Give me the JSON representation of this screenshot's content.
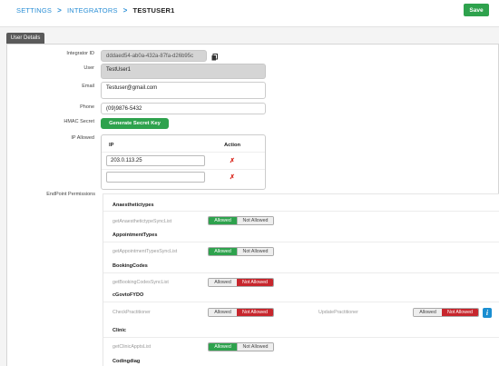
{
  "breadcrumb": {
    "settings": "SETTINGS",
    "integrators": "INTEGRATORS",
    "current": "TESTUSER1",
    "sep": ">"
  },
  "header": {
    "save_label": "Save"
  },
  "tab": {
    "label": "User Details"
  },
  "form": {
    "integrator_id_label": "Integrator ID",
    "integrator_id_value": "dddaed54-ab0a-432a-87fa-d26b95c",
    "user_label": "User",
    "user_value": "TestUser1",
    "email_label": "Email",
    "email_value": "Testuser@gmail.com",
    "phone_label": "Phone",
    "phone_value": "(09)9876-5432",
    "hmac_label": "HMAC Secret",
    "generate_label": "Generate Secret Key",
    "ip_label": "IP Allowed"
  },
  "ip_table": {
    "col_ip": "IP",
    "col_action": "Action",
    "rows": [
      "203.0.113.25",
      ""
    ],
    "remove_glyph": "✗"
  },
  "endpoints": {
    "label": "EndPoint Permissions",
    "allowed_label": "Allowed",
    "not_allowed_label": "Not Allowed",
    "groups": [
      {
        "title": "Anaesthetictypes",
        "items": [
          {
            "name": "getAnaesthetictypeSyncList",
            "state": "allowed"
          }
        ]
      },
      {
        "title": "AppointmentTypes",
        "items": [
          {
            "name": "getAppointmentTypesSyncList",
            "state": "allowed"
          }
        ]
      },
      {
        "title": "BookingCodes",
        "items": [
          {
            "name": "getBookingCodesSyncList",
            "state": "not_allowed"
          }
        ]
      },
      {
        "title": "cGovtoFYDO",
        "items": [
          {
            "name": "CheckPractitioner",
            "state": "not_allowed"
          },
          {
            "name": "UpdatePractitioner",
            "state": "not_allowed"
          }
        ]
      },
      {
        "title": "Clinic",
        "items": [
          {
            "name": "getClinicApptsList",
            "state": "allowed"
          }
        ]
      },
      {
        "title": "Codingdiag",
        "items": []
      }
    ]
  },
  "colors": {
    "accent": "#2b8fd6",
    "success": "#2ea24d",
    "danger": "#c7262d",
    "tab": "#5a5a5a",
    "info": "#1a8ed1"
  },
  "icons": {
    "copy": "copy-icon",
    "remove": "remove-icon",
    "info": "info-icon"
  }
}
